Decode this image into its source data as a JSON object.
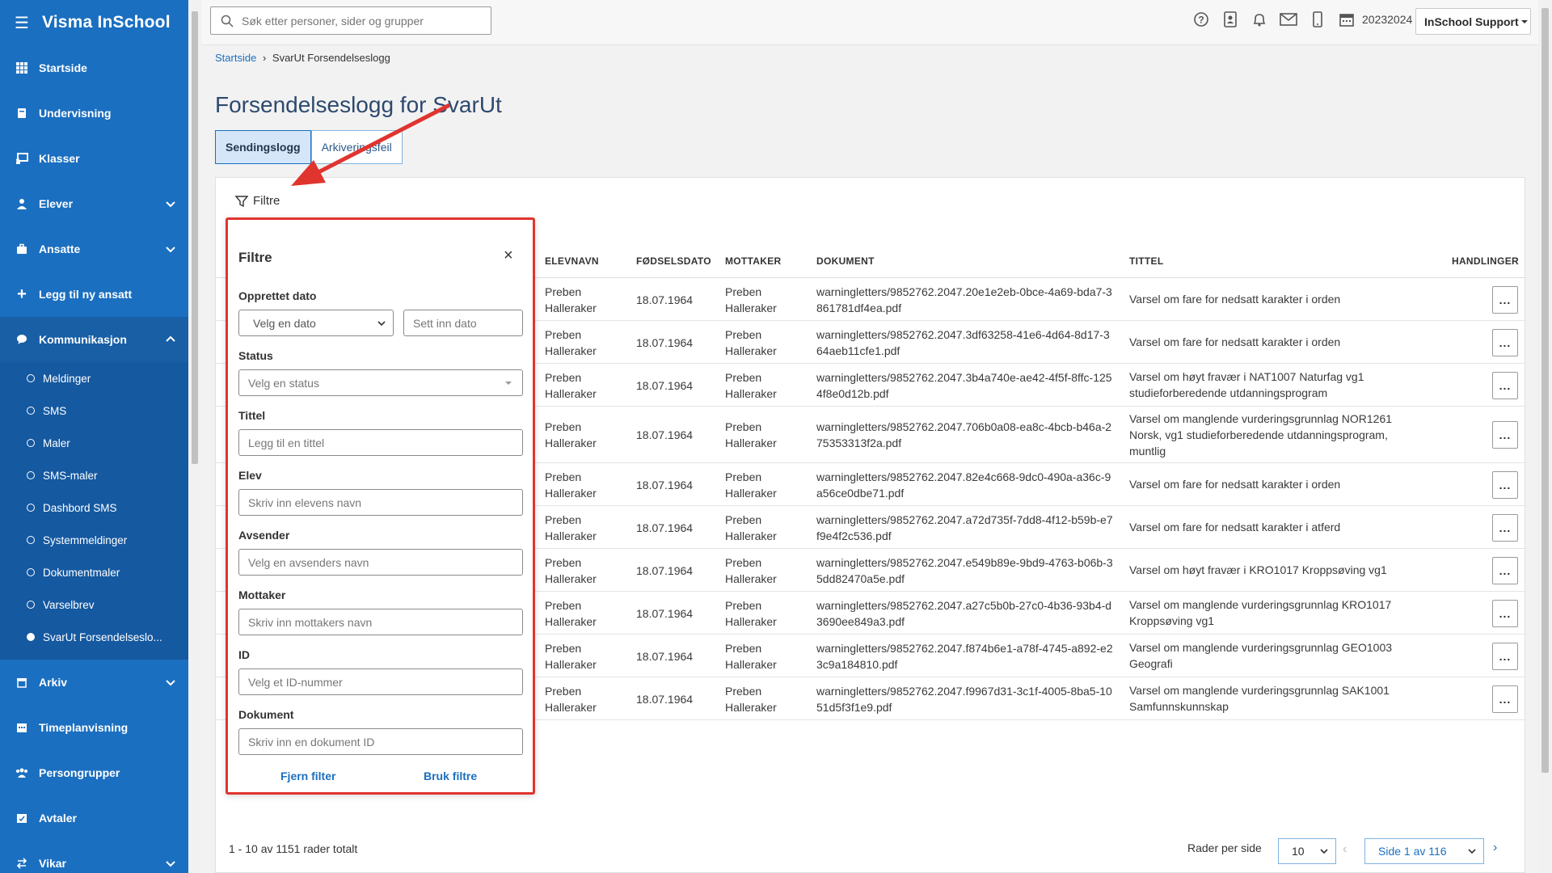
{
  "app": {
    "brand": "Visma InSchool",
    "search_placeholder": "Søk etter personer, sider og grupper",
    "school_year": "20232024",
    "user_menu": "InSchool Support"
  },
  "sidebar": {
    "items": [
      {
        "label": "Startside",
        "icon": "grid-icon"
      },
      {
        "label": "Undervisning",
        "icon": "book-icon"
      },
      {
        "label": "Klasser",
        "icon": "chalkboard-icon"
      },
      {
        "label": "Elever",
        "icon": "student-icon",
        "chevron": "down"
      },
      {
        "label": "Ansatte",
        "icon": "briefcase-icon",
        "chevron": "down"
      },
      {
        "label": "Legg til ny ansatt",
        "icon": "plus-icon"
      },
      {
        "label": "Kommunikasjon",
        "icon": "chat-icon",
        "chevron": "up"
      }
    ],
    "sub_items": [
      "Meldinger",
      "SMS",
      "Maler",
      "SMS-maler",
      "Dashbord SMS",
      "Systemmeldinger",
      "Dokumentmaler",
      "Varselbrev",
      "SvarUt Forsendelseslo..."
    ],
    "bottom_items": [
      {
        "label": "Arkiv",
        "icon": "archive-icon",
        "chevron": "down"
      },
      {
        "label": "Timeplanvisning",
        "icon": "calendar-icon"
      },
      {
        "label": "Persongrupper",
        "icon": "people-icon"
      },
      {
        "label": "Avtaler",
        "icon": "agreement-icon"
      },
      {
        "label": "Vikar",
        "icon": "swap-icon",
        "chevron": "down"
      }
    ]
  },
  "breadcrumb": {
    "home": "Startside",
    "current": "SvarUt Forsendelseslogg"
  },
  "page": {
    "title": "Forsendelseslogg for SvarUt",
    "tabs": [
      "Sendingslogg",
      "Arkiveringsfeil"
    ],
    "filter_toggle": "Filtre"
  },
  "table": {
    "headers": [
      "ELEVNAVN",
      "FØDSELSDATO",
      "MOTTAKER",
      "DOKUMENT",
      "TITTEL",
      "HANDLINGER"
    ],
    "rows": [
      {
        "elev": "Preben Halleraker",
        "dato": "18.07.1964",
        "mottaker": "Preben Halleraker",
        "dokument": "warningletters/9852762.2047.20e1e2eb-0bce-4a69-bda7-3861781df4ea.pdf",
        "tittel": "Varsel om fare for nedsatt karakter i orden"
      },
      {
        "elev": "Preben Halleraker",
        "dato": "18.07.1964",
        "mottaker": "Preben Halleraker",
        "dokument": "warningletters/9852762.2047.3df63258-41e6-4d64-8d17-364aeb11cfe1.pdf",
        "tittel": "Varsel om fare for nedsatt karakter i orden"
      },
      {
        "elev": "Preben Halleraker",
        "dato": "18.07.1964",
        "mottaker": "Preben Halleraker",
        "dokument": "warningletters/9852762.2047.3b4a740e-ae42-4f5f-8ffc-1254f8e0d12b.pdf",
        "tittel": "Varsel om høyt fravær i NAT1007 Naturfag vg1 studieforberedende utdanningsprogram"
      },
      {
        "elev": "Preben Halleraker",
        "dato": "18.07.1964",
        "mottaker": "Preben Halleraker",
        "dokument": "warningletters/9852762.2047.706b0a08-ea8c-4bcb-b46a-275353313f2a.pdf",
        "tittel": "Varsel om manglende vurderingsgrunnlag NOR1261 Norsk, vg1 studieforberedende utdanningsprogram, muntlig"
      },
      {
        "elev": "Preben Halleraker",
        "dato": "18.07.1964",
        "mottaker": "Preben Halleraker",
        "dokument": "warningletters/9852762.2047.82e4c668-9dc0-490a-a36c-9a56ce0dbe71.pdf",
        "tittel": "Varsel om fare for nedsatt karakter i orden"
      },
      {
        "elev": "Preben Halleraker",
        "dato": "18.07.1964",
        "mottaker": "Preben Halleraker",
        "dokument": "warningletters/9852762.2047.a72d735f-7dd8-4f12-b59b-e7f9e4f2c536.pdf",
        "tittel": "Varsel om fare for nedsatt karakter i atferd"
      },
      {
        "elev": "Preben Halleraker",
        "dato": "18.07.1964",
        "mottaker": "Preben Halleraker",
        "dokument": "warningletters/9852762.2047.e549b89e-9bd9-4763-b06b-35dd82470a5e.pdf",
        "tittel": "Varsel om høyt fravær i KRO1017 Kroppsøving vg1"
      },
      {
        "elev": "Preben Halleraker",
        "dato": "18.07.1964",
        "mottaker": "Preben Halleraker",
        "dokument": "warningletters/9852762.2047.a27c5b0b-27c0-4b36-93b4-d3690ee849a3.pdf",
        "tittel": "Varsel om manglende vurderingsgrunnlag KRO1017 Kroppsøving vg1"
      },
      {
        "elev": "Preben Halleraker",
        "dato": "18.07.1964",
        "mottaker": "Preben Halleraker",
        "dokument": "warningletters/9852762.2047.f874b6e1-a78f-4745-a892-e23c9a184810.pdf",
        "tittel": "Varsel om manglende vurderingsgrunnlag GEO1003 Geografi"
      },
      {
        "elev": "Preben Halleraker",
        "dato": "18.07.1964",
        "mottaker": "Preben Halleraker",
        "dokument": "warningletters/9852762.2047.f9967d31-3c1f-4005-8ba5-1051d5f3f1e9.pdf",
        "tittel": "Varsel om manglende vurderingsgrunnlag SAK1001 Samfunnskunnskap"
      }
    ],
    "action_label": "...",
    "total_text": "1 - 10 av 1151 rader totalt",
    "rows_per_page_label": "Rader per side",
    "rows_per_page_value": "10",
    "page_value": "Side 1 av 116"
  },
  "filter_popup": {
    "title": "Filtre",
    "close": "×",
    "fields": [
      {
        "label": "Opprettet dato",
        "placeholder": "Velg en dato",
        "placeholder2": "Sett inn dato"
      },
      {
        "label": "Status",
        "placeholder": "Velg en status"
      },
      {
        "label": "Tittel",
        "placeholder": "Legg til en tittel"
      },
      {
        "label": "Elev",
        "placeholder": "Skriv inn elevens navn"
      },
      {
        "label": "Avsender",
        "placeholder": "Velg en avsenders navn"
      },
      {
        "label": "Mottaker",
        "placeholder": "Skriv inn mottakers navn"
      },
      {
        "label": "ID",
        "placeholder": "Velg et ID-nummer"
      },
      {
        "label": "Dokument",
        "placeholder": "Skriv inn en dokument ID"
      }
    ],
    "clear_label": "Fjern filter",
    "apply_label": "Bruk filtre"
  },
  "colors": {
    "sidebar": "#1b6fc0",
    "accent": "#1b6fc0",
    "annotation": "#e0342f"
  }
}
